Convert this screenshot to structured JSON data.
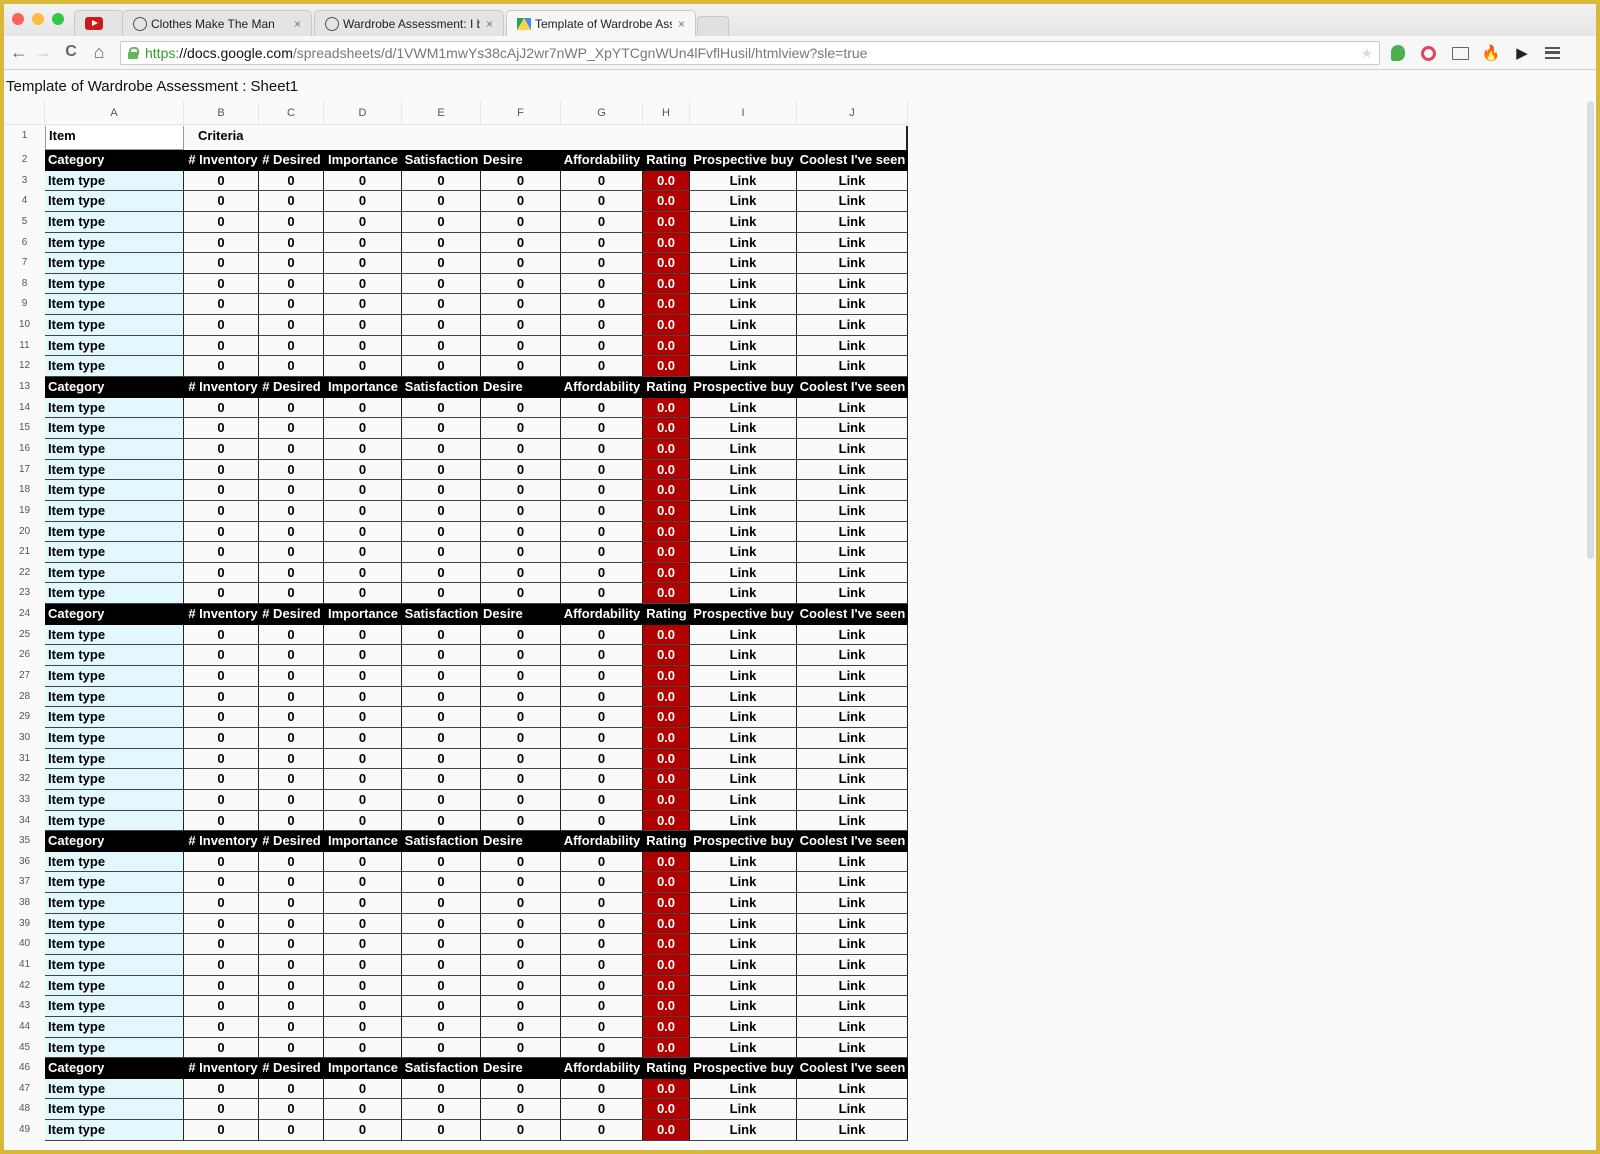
{
  "browser": {
    "tabs": [
      {
        "icon": "youtube-icon",
        "title": ""
      },
      {
        "icon": "reddit-icon",
        "title": "Clothes Make The Man"
      },
      {
        "icon": "reddit-icon",
        "title": "Wardrobe Assessment: I b"
      },
      {
        "icon": "google-drive-icon",
        "title": "Template of Wardrobe Ass",
        "active": true
      }
    ],
    "tab_close": "×",
    "url": {
      "scheme": "https:",
      "host": "//docs.google.com",
      "path": "/spreadsheets/d/1VWM1mwYs38cAjJ2wr7nWP_XpYTCgnWUn4lFvflHusil/htmlview?sle=true"
    },
    "nav": {
      "back": "←",
      "forward": "→",
      "reload": "C",
      "home": "⌂"
    },
    "extensions": [
      "hangouts-icon",
      "opera-icon",
      "cast-icon",
      "fire-icon",
      "cursor-icon",
      "menu-icon"
    ]
  },
  "page": {
    "title": "Template of Wardrobe Assessment : Sheet1"
  },
  "sheet": {
    "columns": [
      "A",
      "B",
      "C",
      "D",
      "E",
      "F",
      "G",
      "H",
      "I",
      "J"
    ],
    "title_row": {
      "item": "Item",
      "criteria": "Criteria"
    },
    "header": [
      "Category",
      "# Inventory",
      "# Desired",
      "Importance",
      "Satisfaction",
      "Desire",
      "Affordability",
      "Rating",
      "Prospective buy",
      "Coolest I've seen"
    ],
    "data_row": [
      "Item type",
      "0",
      "0",
      "0",
      "0",
      "0",
      "0",
      "0.0",
      "Link",
      "Link"
    ],
    "header_rows": [
      2,
      13,
      24,
      35,
      46
    ],
    "row_count": 49,
    "colors": {
      "header_bg": "#000000",
      "item_bg": "#e3f8fc",
      "rating_bg": "#b00000"
    }
  }
}
